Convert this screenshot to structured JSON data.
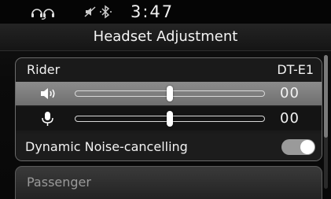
{
  "status_bar": {
    "time": "3:47",
    "icons": [
      "headset-pair-icon",
      "mute-icon",
      "bluetooth-icon"
    ]
  },
  "header": {
    "title": "Headset Adjustment"
  },
  "rider": {
    "label": "Rider",
    "device": "DT-E1",
    "speaker_volume": {
      "icon": "speaker-icon",
      "value": "00",
      "level": 0.5,
      "selected": true
    },
    "mic_volume": {
      "icon": "microphone-icon",
      "value": "00",
      "level": 0.5
    },
    "noise_cancelling": {
      "label": "Dynamic Noise-cancelling",
      "enabled": true
    }
  },
  "passenger": {
    "label": "Passenger"
  },
  "colors": {
    "selected_row": "#7d7d7d",
    "toggle_on": "#9a9a9a",
    "panel_border": "#6b6b6b"
  }
}
